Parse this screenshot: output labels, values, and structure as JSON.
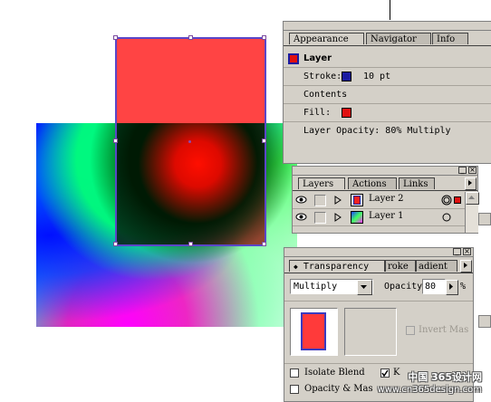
{
  "appearance_panel": {
    "tabs": [
      "Appearance",
      "Navigator",
      "Info"
    ],
    "target_label": "Layer",
    "stroke_label": "Stroke:",
    "stroke_weight": "10 pt",
    "contents_label": "Contents",
    "fill_label": "Fill:",
    "opacity_line": "Layer Opacity: 80% Multiply",
    "stroke_color": "#1a1aa0",
    "fill_color": "#e01010"
  },
  "layers_panel": {
    "tabs": [
      "Layers",
      "Actions",
      "Links"
    ],
    "layers": [
      {
        "name": "Layer 2",
        "thumb_color": "#ee2222"
      },
      {
        "name": "Layer 1",
        "thumb_color": "gradient"
      }
    ]
  },
  "transparency_panel": {
    "tabs": [
      "Transparency",
      "roke",
      "adient"
    ],
    "blend_mode": "Multiply",
    "opacity_label": "Opacity:",
    "opacity_value": "80",
    "opacity_unit": "%",
    "invert_mask_label": "Invert Mas",
    "isolate_label": "Isolate Blend",
    "knockout_label": "K",
    "opacity_mask_label": "Opacity & Mas",
    "preview_color": "#ff3a3a"
  },
  "watermark": {
    "line1": "中国 365设计网",
    "line2": "www.cn365design.com"
  },
  "canvas": {
    "red_rect_color": "#ff2a2a",
    "selection_color": "#5a46c8"
  }
}
